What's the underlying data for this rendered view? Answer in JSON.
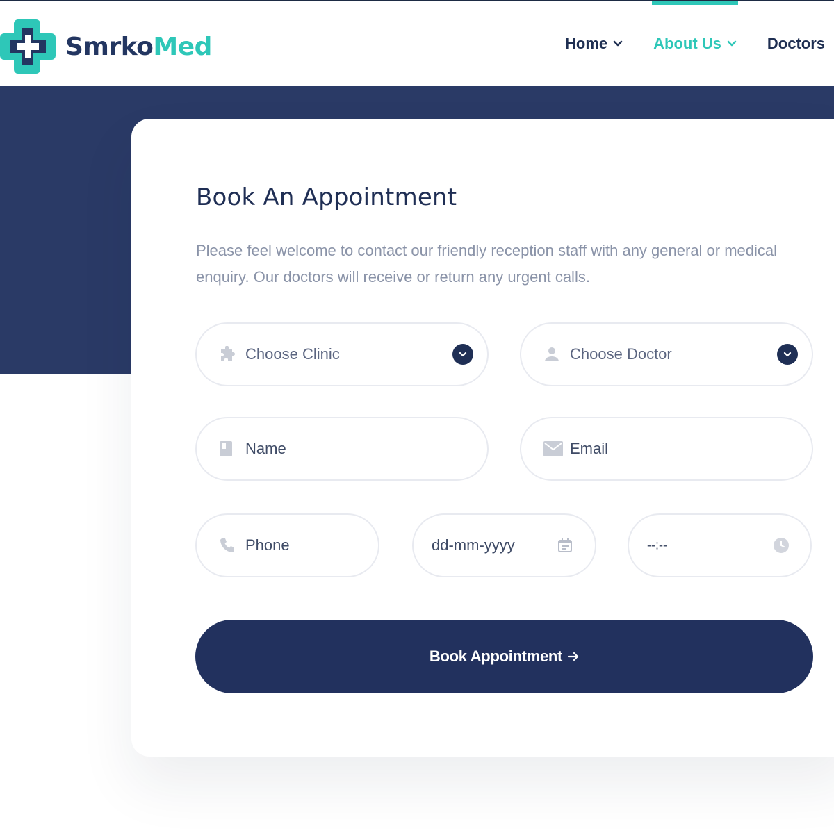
{
  "brand": {
    "name_part1": "Smrko",
    "name_part2": "Med",
    "colors": {
      "navy": "#233661",
      "teal": "#2ec7b8"
    },
    "logo_icon": "medical-cross-logo"
  },
  "nav": {
    "items": [
      {
        "label": "Home",
        "has_dropdown": true,
        "active": false
      },
      {
        "label": "About Us",
        "has_dropdown": true,
        "active": true
      },
      {
        "label": "Doctors",
        "has_dropdown": false,
        "active": false
      }
    ]
  },
  "appointment": {
    "title": "Book An Appointment",
    "description": "Please feel welcome to contact our friendly reception staff with any general or medical enquiry. Our doctors will receive or return any urgent calls.",
    "fields": {
      "clinic": {
        "placeholder": "Choose Clinic",
        "icon": "puzzle-icon"
      },
      "doctor": {
        "placeholder": "Choose Doctor",
        "icon": "user-icon"
      },
      "name": {
        "placeholder": "Name",
        "icon": "id-card-icon"
      },
      "email": {
        "placeholder": "Email",
        "icon": "envelope-icon"
      },
      "phone": {
        "placeholder": "Phone",
        "icon": "phone-icon"
      },
      "date": {
        "placeholder": "dd-mm-yyyy",
        "icon": "calendar-icon"
      },
      "time": {
        "placeholder": "--:--",
        "icon": "clock-icon"
      }
    },
    "submit_label": "Book Appointment"
  },
  "colors": {
    "hero_bg": "#2a3a66",
    "button_bg": "#22315e",
    "accent": "#2ec7b8",
    "text_muted": "#8a93a8"
  }
}
